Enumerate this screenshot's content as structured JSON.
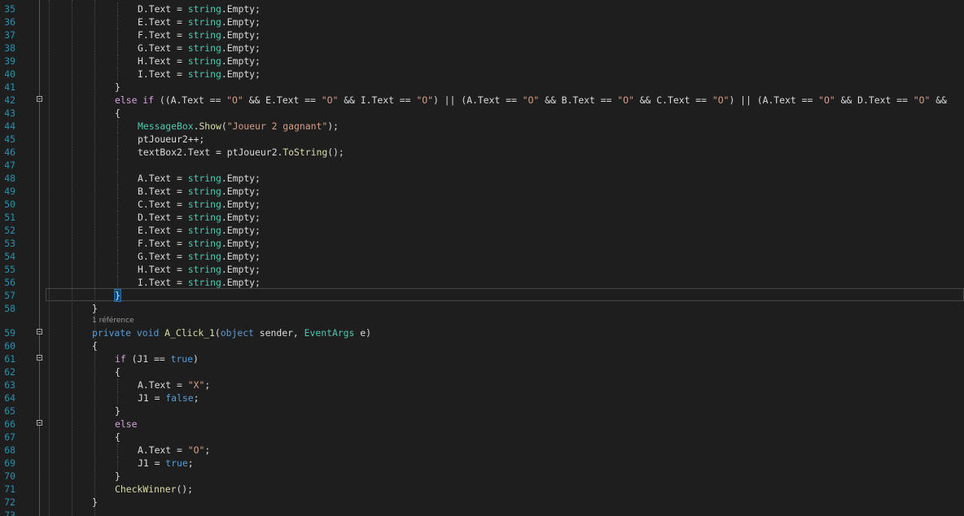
{
  "editor": {
    "language": "C#",
    "codelens_references": "1 référence",
    "lines": [
      {
        "n": "35",
        "indent": 4,
        "tokens": [
          [
            "plain",
            "D.Text = "
          ],
          [
            "type",
            "string"
          ],
          [
            "plain",
            ".Empty;"
          ]
        ]
      },
      {
        "n": "36",
        "indent": 4,
        "tokens": [
          [
            "plain",
            "E.Text = "
          ],
          [
            "type",
            "string"
          ],
          [
            "plain",
            ".Empty;"
          ]
        ]
      },
      {
        "n": "37",
        "indent": 4,
        "tokens": [
          [
            "plain",
            "F.Text = "
          ],
          [
            "type",
            "string"
          ],
          [
            "plain",
            ".Empty;"
          ]
        ]
      },
      {
        "n": "38",
        "indent": 4,
        "tokens": [
          [
            "plain",
            "G.Text = "
          ],
          [
            "type",
            "string"
          ],
          [
            "plain",
            ".Empty;"
          ]
        ]
      },
      {
        "n": "39",
        "indent": 4,
        "tokens": [
          [
            "plain",
            "H.Text = "
          ],
          [
            "type",
            "string"
          ],
          [
            "plain",
            ".Empty;"
          ]
        ]
      },
      {
        "n": "40",
        "indent": 4,
        "tokens": [
          [
            "plain",
            "I.Text = "
          ],
          [
            "type",
            "string"
          ],
          [
            "plain",
            ".Empty;"
          ]
        ]
      },
      {
        "n": "41",
        "indent": 3,
        "tokens": [
          [
            "plain",
            "}"
          ]
        ]
      },
      {
        "n": "42",
        "indent": 3,
        "fold": true,
        "tokens": [
          [
            "ctl",
            "else"
          ],
          [
            "plain",
            " "
          ],
          [
            "ctl",
            "if"
          ],
          [
            "plain",
            " ((A.Text == "
          ],
          [
            "str",
            "\"O\""
          ],
          [
            "plain",
            " && E.Text == "
          ],
          [
            "str",
            "\"O\""
          ],
          [
            "plain",
            " && I.Text == "
          ],
          [
            "str",
            "\"O\""
          ],
          [
            "plain",
            ") || (A.Text == "
          ],
          [
            "str",
            "\"O\""
          ],
          [
            "plain",
            " && B.Text == "
          ],
          [
            "str",
            "\"O\""
          ],
          [
            "plain",
            " && C.Text == "
          ],
          [
            "str",
            "\"O\""
          ],
          [
            "plain",
            ") || (A.Text == "
          ],
          [
            "str",
            "\"O\""
          ],
          [
            "plain",
            " && D.Text == "
          ],
          [
            "str",
            "\"O\""
          ],
          [
            "plain",
            " &&"
          ]
        ]
      },
      {
        "n": "43",
        "indent": 3,
        "tokens": [
          [
            "plain",
            "{"
          ]
        ]
      },
      {
        "n": "44",
        "indent": 4,
        "tokens": [
          [
            "type",
            "MessageBox"
          ],
          [
            "plain",
            "."
          ],
          [
            "meth",
            "Show"
          ],
          [
            "plain",
            "("
          ],
          [
            "str",
            "\"Joueur 2 gagnant\""
          ],
          [
            "plain",
            ");"
          ]
        ]
      },
      {
        "n": "45",
        "indent": 4,
        "tokens": [
          [
            "plain",
            "ptJoueur2++;"
          ]
        ]
      },
      {
        "n": "46",
        "indent": 4,
        "tokens": [
          [
            "plain",
            "textBox2.Text = ptJoueur2."
          ],
          [
            "meth",
            "ToString"
          ],
          [
            "plain",
            "();"
          ]
        ]
      },
      {
        "n": "47",
        "indent": 4,
        "tokens": []
      },
      {
        "n": "48",
        "indent": 4,
        "tokens": [
          [
            "plain",
            "A.Text = "
          ],
          [
            "type",
            "string"
          ],
          [
            "plain",
            ".Empty;"
          ]
        ]
      },
      {
        "n": "49",
        "indent": 4,
        "tokens": [
          [
            "plain",
            "B.Text = "
          ],
          [
            "type",
            "string"
          ],
          [
            "plain",
            ".Empty;"
          ]
        ]
      },
      {
        "n": "50",
        "indent": 4,
        "tokens": [
          [
            "plain",
            "C.Text = "
          ],
          [
            "type",
            "string"
          ],
          [
            "plain",
            ".Empty;"
          ]
        ]
      },
      {
        "n": "51",
        "indent": 4,
        "tokens": [
          [
            "plain",
            "D.Text = "
          ],
          [
            "type",
            "string"
          ],
          [
            "plain",
            ".Empty;"
          ]
        ]
      },
      {
        "n": "52",
        "indent": 4,
        "tokens": [
          [
            "plain",
            "E.Text = "
          ],
          [
            "type",
            "string"
          ],
          [
            "plain",
            ".Empty;"
          ]
        ]
      },
      {
        "n": "53",
        "indent": 4,
        "tokens": [
          [
            "plain",
            "F.Text = "
          ],
          [
            "type",
            "string"
          ],
          [
            "plain",
            ".Empty;"
          ]
        ]
      },
      {
        "n": "54",
        "indent": 4,
        "tokens": [
          [
            "plain",
            "G.Text = "
          ],
          [
            "type",
            "string"
          ],
          [
            "plain",
            ".Empty;"
          ]
        ]
      },
      {
        "n": "55",
        "indent": 4,
        "tokens": [
          [
            "plain",
            "H.Text = "
          ],
          [
            "type",
            "string"
          ],
          [
            "plain",
            ".Empty;"
          ]
        ]
      },
      {
        "n": "56",
        "indent": 4,
        "tokens": [
          [
            "plain",
            "I.Text = "
          ],
          [
            "type",
            "string"
          ],
          [
            "plain",
            ".Empty;"
          ]
        ]
      },
      {
        "n": "57",
        "indent": 3,
        "current": true,
        "tokens": [
          [
            "plain",
            "}"
          ]
        ]
      },
      {
        "n": "58",
        "indent": 2,
        "tokens": [
          [
            "plain",
            "}"
          ]
        ]
      },
      {
        "n": "59",
        "indent": 2,
        "fold": true,
        "codelens_above": true,
        "tokens": [
          [
            "kw",
            "private"
          ],
          [
            "plain",
            " "
          ],
          [
            "kw",
            "void"
          ],
          [
            "plain",
            " "
          ],
          [
            "meth",
            "A_Click_1"
          ],
          [
            "plain",
            "("
          ],
          [
            "kw",
            "object"
          ],
          [
            "plain",
            " sender, "
          ],
          [
            "type",
            "EventArgs"
          ],
          [
            "plain",
            " e)"
          ]
        ]
      },
      {
        "n": "60",
        "indent": 2,
        "tokens": [
          [
            "plain",
            "{"
          ]
        ]
      },
      {
        "n": "61",
        "indent": 3,
        "fold": true,
        "tokens": [
          [
            "ctl",
            "if"
          ],
          [
            "plain",
            " (J1 == "
          ],
          [
            "kw",
            "true"
          ],
          [
            "plain",
            ")"
          ]
        ]
      },
      {
        "n": "62",
        "indent": 3,
        "tokens": [
          [
            "plain",
            "{"
          ]
        ]
      },
      {
        "n": "63",
        "indent": 4,
        "tokens": [
          [
            "plain",
            "A.Text = "
          ],
          [
            "str",
            "\"X\""
          ],
          [
            "plain",
            ";"
          ]
        ]
      },
      {
        "n": "64",
        "indent": 4,
        "tokens": [
          [
            "plain",
            "J1 = "
          ],
          [
            "kw",
            "false"
          ],
          [
            "plain",
            ";"
          ]
        ]
      },
      {
        "n": "65",
        "indent": 3,
        "tokens": [
          [
            "plain",
            "}"
          ]
        ]
      },
      {
        "n": "66",
        "indent": 3,
        "fold": true,
        "tokens": [
          [
            "ctl",
            "else"
          ]
        ]
      },
      {
        "n": "67",
        "indent": 3,
        "tokens": [
          [
            "plain",
            "{"
          ]
        ]
      },
      {
        "n": "68",
        "indent": 4,
        "tokens": [
          [
            "plain",
            "A.Text = "
          ],
          [
            "str",
            "\"O\""
          ],
          [
            "plain",
            ";"
          ]
        ]
      },
      {
        "n": "69",
        "indent": 4,
        "tokens": [
          [
            "plain",
            "J1 = "
          ],
          [
            "kw",
            "true"
          ],
          [
            "plain",
            ";"
          ]
        ]
      },
      {
        "n": "70",
        "indent": 3,
        "tokens": [
          [
            "plain",
            "}"
          ]
        ]
      },
      {
        "n": "71",
        "indent": 3,
        "tokens": [
          [
            "meth",
            "CheckWinner"
          ],
          [
            "plain",
            "();"
          ]
        ]
      },
      {
        "n": "72",
        "indent": 2,
        "tokens": [
          [
            "plain",
            "}"
          ]
        ]
      },
      {
        "n": "73",
        "indent": 2,
        "tokens": []
      }
    ]
  },
  "colors": {
    "background": "#1e1e1e",
    "line_number": "#2b91af",
    "keyword": "#569cd6",
    "control_keyword": "#d8a0df",
    "string": "#d69d85",
    "type": "#4ec9b0",
    "method": "#dcdcaa",
    "plain": "#dcdcdc"
  }
}
